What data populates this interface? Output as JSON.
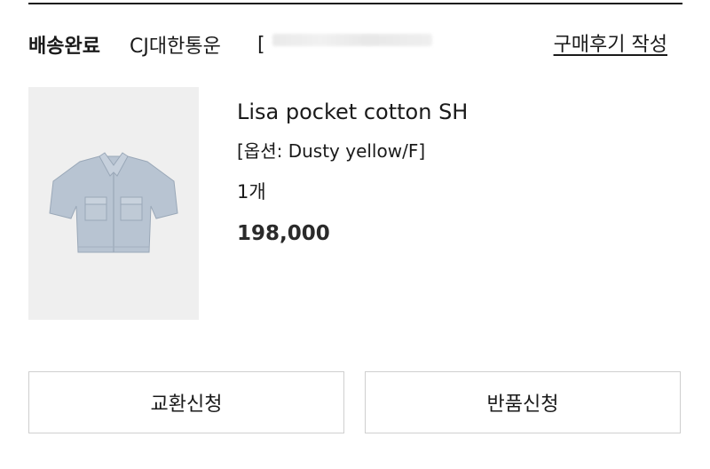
{
  "order": {
    "status": "배송완료",
    "carrier": "CJ대한통운",
    "tracking_bracket": "[",
    "review_link": "구매후기 작성"
  },
  "product": {
    "name": "Lisa pocket cotton SH",
    "option": "[옵션: Dusty yellow/F]",
    "quantity": "1개",
    "price": "198,000",
    "image_icon": "shirt-icon",
    "image_bg_color": "#efefef",
    "shirt_color": "#b8c4d2"
  },
  "actions": {
    "exchange_label": "교환신청",
    "return_label": "반품신청"
  }
}
